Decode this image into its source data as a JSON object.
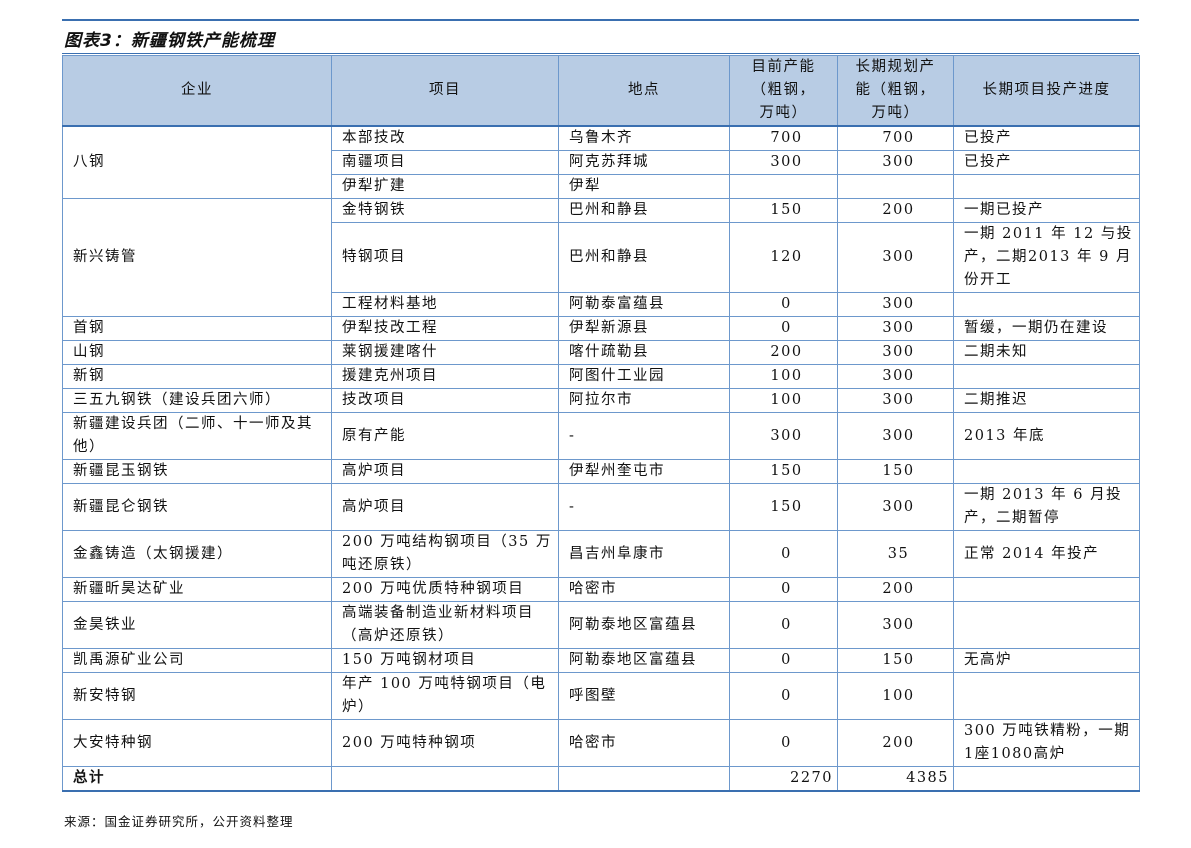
{
  "figure_title": "图表3：新疆钢铁产能梳理",
  "headers": {
    "company": "企业",
    "project": "项目",
    "location": "地点",
    "current_capacity": "目前产能（粗钢，万吨）",
    "planned_capacity": "长期规划产能（粗钢，万吨）",
    "progress": "长期项目投产进度"
  },
  "groups": [
    {
      "company": "八钢",
      "rows": [
        {
          "project": "本部技改",
          "location": "乌鲁木齐",
          "current": "700",
          "planned": "700",
          "progress": "已投产"
        },
        {
          "project": "南疆项目",
          "location": "阿克苏拜城",
          "current": "300",
          "planned": "300",
          "progress": "已投产"
        },
        {
          "project": "伊犁扩建",
          "location": "伊犁",
          "current": "",
          "planned": "",
          "progress": ""
        }
      ]
    },
    {
      "company": "新兴铸管",
      "rows": [
        {
          "project": "金特钢铁",
          "location": "巴州和静县",
          "current": "150",
          "planned": "200",
          "progress": "一期已投产"
        },
        {
          "project": "特钢项目",
          "location": "巴州和静县",
          "current": "120",
          "planned": "300",
          "progress": "一期 2011 年 12 与投产，二期2013 年 9 月份开工"
        },
        {
          "project": "工程材料基地",
          "location": "阿勒泰富蕴县",
          "current": "0",
          "planned": "300",
          "progress": ""
        }
      ]
    },
    {
      "company": "首钢",
      "rows": [
        {
          "project": "伊犁技改工程",
          "location": "伊犁新源县",
          "current": "0",
          "planned": "300",
          "progress": "暂缓，一期仍在建设"
        }
      ]
    },
    {
      "company": "山钢",
      "rows": [
        {
          "project": "莱钢援建喀什",
          "location": "喀什疏勒县",
          "current": "200",
          "planned": "300",
          "progress": "二期未知"
        }
      ]
    },
    {
      "company": "新钢",
      "rows": [
        {
          "project": "援建克州项目",
          "location": "阿图什工业园",
          "current": "100",
          "planned": "300",
          "progress": ""
        }
      ]
    },
    {
      "company": "三五九钢铁（建设兵团六师）",
      "rows": [
        {
          "project": "技改项目",
          "location": "阿拉尔市",
          "current": "100",
          "planned": "300",
          "progress": "二期推迟"
        }
      ]
    },
    {
      "company": "新疆建设兵团（二师、十一师及其他）",
      "rows": [
        {
          "project": "原有产能",
          "location": "-",
          "current": "300",
          "planned": "300",
          "progress": "2013 年底"
        }
      ]
    },
    {
      "company": "新疆昆玉钢铁",
      "rows": [
        {
          "project": "高炉项目",
          "location": "伊犁州奎屯市",
          "current": "150",
          "planned": "150",
          "progress": ""
        }
      ]
    },
    {
      "company": "新疆昆仑钢铁",
      "rows": [
        {
          "project": "高炉项目",
          "location": "-",
          "current": "150",
          "planned": "300",
          "progress": "一期 2013 年 6 月投产，二期暂停"
        }
      ]
    },
    {
      "company": "金鑫铸造（太钢援建）",
      "rows": [
        {
          "project": "200 万吨结构钢项目（35 万吨还原铁）",
          "location": "昌吉州阜康市",
          "current": "0",
          "planned": "35",
          "progress": "正常 2014 年投产"
        }
      ]
    },
    {
      "company": "新疆昕昊达矿业",
      "rows": [
        {
          "project": "200 万吨优质特种钢项目",
          "location": "哈密市",
          "current": "0",
          "planned": "200",
          "progress": ""
        }
      ]
    },
    {
      "company": "金昊铁业",
      "rows": [
        {
          "project": "高端装备制造业新材料项目（高炉还原铁）",
          "location": "阿勒泰地区富蕴县",
          "current": "0",
          "planned": "300",
          "progress": ""
        }
      ]
    },
    {
      "company": "凯禹源矿业公司",
      "rows": [
        {
          "project": "150 万吨钢材项目",
          "location": "阿勒泰地区富蕴县",
          "current": "0",
          "planned": "150",
          "progress": "无高炉"
        }
      ]
    },
    {
      "company": "新安特钢",
      "rows": [
        {
          "project": "年产 100 万吨特钢项目（电炉）",
          "location": "呼图壁",
          "current": "0",
          "planned": "100",
          "progress": ""
        }
      ]
    },
    {
      "company": "大安特种钢",
      "rows": [
        {
          "project": "200 万吨特种钢项",
          "location": "哈密市",
          "current": "0",
          "planned": "200",
          "progress": "300 万吨铁精粉，一期1座1080高炉"
        }
      ]
    }
  ],
  "total": {
    "label": "总计",
    "current": "2270",
    "planned": "4385"
  },
  "source": "来源：国金证券研究所，公开资料整理"
}
